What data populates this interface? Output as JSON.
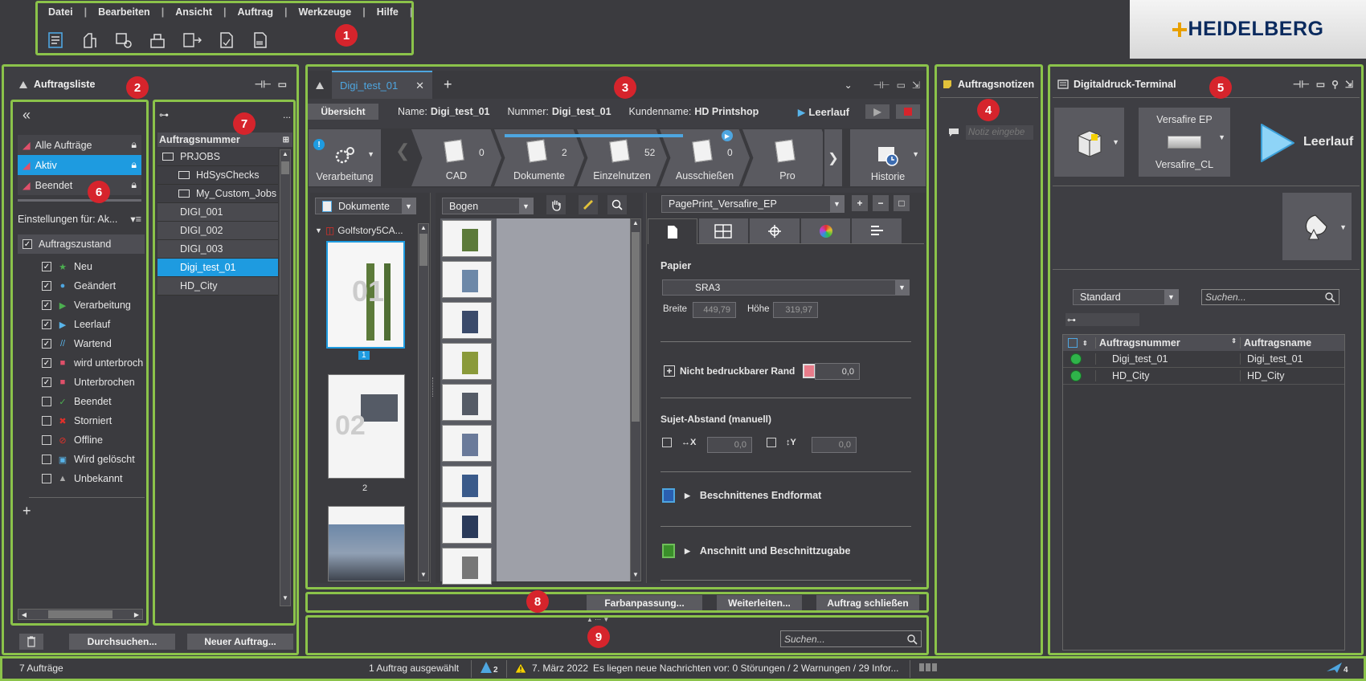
{
  "menu": {
    "items": [
      "Datei",
      "Bearbeiten",
      "Ansicht",
      "Auftrag",
      "Werkzeuge",
      "Hilfe"
    ],
    "toolbar_icons": [
      "job-list-icon",
      "machine-icon",
      "settings-icon",
      "press-icon",
      "abc-icon",
      "document-icon",
      "barcode-icon"
    ]
  },
  "brand": {
    "logo_text": "HEIDELBERG",
    "accent": "#0a2a5e",
    "cross_color": "#e8a000"
  },
  "markers": [
    "1",
    "2",
    "3",
    "4",
    "5",
    "6",
    "7",
    "8",
    "9"
  ],
  "joblist": {
    "title": "Auftragsliste",
    "collapse": "«",
    "filters": [
      {
        "label": "Alle Aufträge",
        "active": false
      },
      {
        "label": "Aktiv",
        "active": true
      },
      {
        "label": "Beendet",
        "active": false
      }
    ],
    "settings_label": "Einstellungen für: Ak...",
    "state_header": "Auftragszustand",
    "states": [
      {
        "label": "Neu",
        "checked": true,
        "icon": "star-icon",
        "color": "#4caf50"
      },
      {
        "label": "Geändert",
        "checked": true,
        "icon": "circle-icon",
        "color": "#4ea6e0"
      },
      {
        "label": "Verarbeitung",
        "checked": true,
        "icon": "play-icon",
        "color": "#4caf50"
      },
      {
        "label": "Leerlauf",
        "checked": true,
        "icon": "play-icon",
        "color": "#58b4ea"
      },
      {
        "label": "Wartend",
        "checked": true,
        "icon": "wait-icon",
        "color": "#58b4ea"
      },
      {
        "label": "wird unterbroch",
        "checked": true,
        "icon": "square-icon",
        "color": "#e0506a"
      },
      {
        "label": "Unterbrochen",
        "checked": true,
        "icon": "square-icon",
        "color": "#e0506a"
      },
      {
        "label": "Beendet",
        "checked": false,
        "icon": "check-icon",
        "color": "#4caf50"
      },
      {
        "label": "Storniert",
        "checked": false,
        "icon": "x-icon",
        "color": "#e0302a"
      },
      {
        "label": "Offline",
        "checked": false,
        "icon": "offline-icon",
        "color": "#e0302a"
      },
      {
        "label": "Wird gelöscht",
        "checked": false,
        "icon": "delete-icon",
        "color": "#58b4ea"
      },
      {
        "label": "Unbekannt",
        "checked": false,
        "icon": "triangle-icon",
        "color": "#aaaaaa"
      }
    ],
    "add": "+",
    "browse_button": "Durchsuchen...",
    "new_job_button": "Neuer Auftrag..."
  },
  "jobtree": {
    "header": "Auftragsnummer",
    "more": "...",
    "items": [
      {
        "label": "PRJOBS",
        "indent": 0,
        "icon": true,
        "selected": false
      },
      {
        "label": "HdSysChecks",
        "indent": 1,
        "icon": true,
        "selected": false
      },
      {
        "label": "My_Custom_Jobs",
        "indent": 1,
        "icon": true,
        "selected": false
      },
      {
        "label": "DIGI_001",
        "indent": 2,
        "icon": false,
        "selected": false
      },
      {
        "label": "DIGI_002",
        "indent": 2,
        "icon": false,
        "selected": false
      },
      {
        "label": "DIGI_003",
        "indent": 2,
        "icon": false,
        "selected": false
      },
      {
        "label": "Digi_test_01",
        "indent": 2,
        "icon": false,
        "selected": true
      },
      {
        "label": "HD_City",
        "indent": 2,
        "icon": false,
        "selected": false
      }
    ]
  },
  "workspace": {
    "tab": "Digi_test_01",
    "tab_close": "✕",
    "tab_add": "+",
    "overview": "Übersicht",
    "name_label": "Name:",
    "name_value": "Digi_test_01",
    "number_label": "Nummer:",
    "number_value": "Digi_test_01",
    "customer_label": "Kundenname:",
    "customer_value": "HD Printshop",
    "run_state": "Leerlauf",
    "stages": [
      {
        "label": "Verarbeitung",
        "count": ""
      },
      {
        "label": "CAD",
        "count": "0"
      },
      {
        "label": "Dokumente",
        "count": "2"
      },
      {
        "label": "Einzelnutzen",
        "count": "52"
      },
      {
        "label": "Ausschießen",
        "count": "0"
      },
      {
        "label": "Pro",
        "count": ""
      },
      {
        "label": "Historie",
        "count": ""
      }
    ],
    "doc_select": "Dokumente",
    "doc_tree_item": "Golfstory5CA...",
    "page_labels": [
      "1",
      "2"
    ],
    "sheet_select": "Bogen",
    "device_select": "PagePrint_Versafire_EP",
    "paper_label": "Papier",
    "paper_value": "SRA3",
    "width_label": "Breite",
    "width_value": "449,79",
    "height_label": "Höhe",
    "height_value": "319,97",
    "margin_label": "Nicht bedruckbarer Rand",
    "margin_value": "0,0",
    "spacing_label": "Sujet-Abstand (manuell)",
    "x_label": "X",
    "x_value": "0,0",
    "y_label": "Y",
    "y_value": "0,0",
    "trim_label": "Beschnittenes Endformat",
    "bleed_label": "Anschnitt und Beschnittzugabe"
  },
  "actions": {
    "color_adjust": "Farbanpassung...",
    "forward": "Weiterleiten...",
    "close_job": "Auftrag schließen"
  },
  "bottom_search": {
    "placeholder": "Suchen..."
  },
  "notes": {
    "title": "Auftragsnotizen",
    "placeholder": "Notiz eingebe"
  },
  "terminal": {
    "title": "Digitaldruck-Terminal",
    "device_name": "Versafire EP",
    "device_sub": "Versafire_CL",
    "state": "Leerlauf",
    "filter_select": "Standard",
    "search_placeholder": "Suchen...",
    "columns": [
      "Auftragsnummer",
      "Auftragsname"
    ],
    "rows": [
      {
        "number": "Digi_test_01",
        "name": "Digi_test_01",
        "status_color": "#2fb34a"
      },
      {
        "number": "HD_City",
        "name": "HD_City",
        "status_color": "#2fb34a"
      }
    ]
  },
  "statusbar": {
    "job_count": "7 Aufträge",
    "selected": "1 Auftrag ausgewählt",
    "badge": "2",
    "date": "7. März 2022",
    "message": "Es liegen neue Nachrichten vor: 0 Störungen / 2 Warnungen / 29 Infor...",
    "right_badge": "4"
  }
}
